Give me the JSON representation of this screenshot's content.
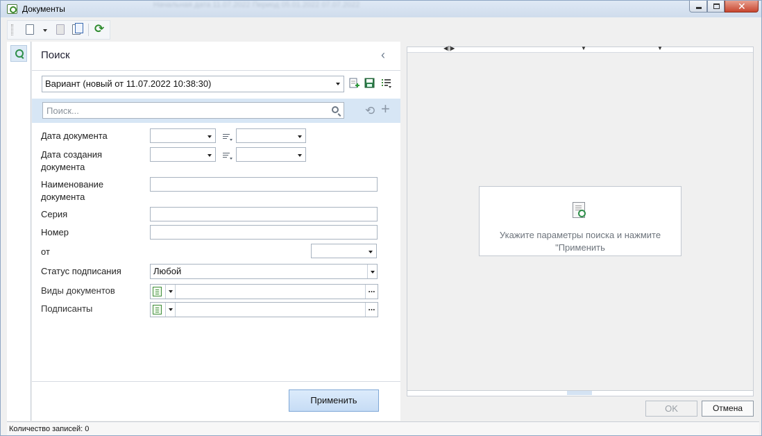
{
  "window": {
    "title": "Документы",
    "background_text": "Начальная дата  11.07.2022   Период  05.01.2022   07.07.2022"
  },
  "toolbar": {
    "new_icon": "new-document-icon",
    "refresh_icon": "refresh-icon"
  },
  "search_panel": {
    "title": "Поиск",
    "variant_value": "Вариант (новый от 11.07.2022 10:38:30)",
    "search_placeholder": "Поиск..."
  },
  "fields": {
    "doc_date": "Дата документа",
    "create_date_line1": "Дата создания",
    "create_date_line2": "документа",
    "name_line1": "Наименование",
    "name_line2": "документа",
    "series": "Серия",
    "number": "Номер",
    "from": "от",
    "sign_status": "Статус подписания",
    "sign_status_value": "Любой",
    "doc_types": "Виды документов",
    "signers": "Подписанты",
    "lookup_dots": "..."
  },
  "buttons": {
    "apply": "Применить",
    "ok": "OK",
    "cancel": "Отмена"
  },
  "results": {
    "hint_line1": "Укажите параметры поиска и нажмите",
    "hint_line2": "\"Применить"
  },
  "status": {
    "record_count": "Количество записей: 0"
  },
  "colors": {
    "accent": "#d7e6f5",
    "apply_button": "#c6dcf5",
    "icon_green": "#2f8f4a"
  }
}
